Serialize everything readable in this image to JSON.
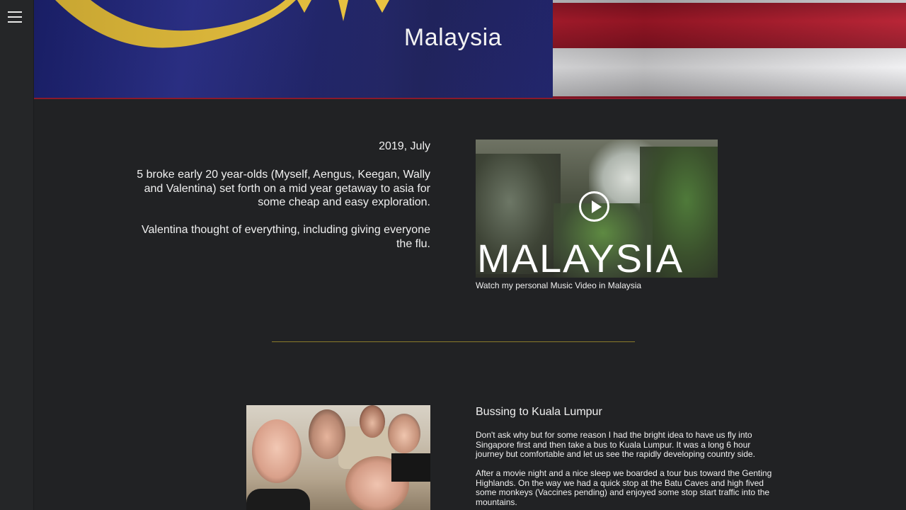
{
  "nav": {
    "menu_icon": "hamburger-menu-icon"
  },
  "banner": {
    "title": "Malaysia",
    "colors": {
      "blue": "#1d2376",
      "red": "#b51a2c",
      "white": "#f0f0f2",
      "yellow": "#e9c13a"
    }
  },
  "intro": {
    "date": "2019, July",
    "paragraphs": [
      "5 broke early 20 year-olds (Myself, Aengus, Keegan, Wally and Valentina) set forth on a mid year getaway to asia for some cheap and easy exploration.",
      "Valentina thought of everything, including giving everyone the flu."
    ]
  },
  "video": {
    "overlay_text": "MALAYSIA",
    "play_icon": "play-circle-icon",
    "caption": "Watch my personal Music Video in Malaysia"
  },
  "divider_color": "#8a7a2a",
  "story": {
    "title": "Bussing to Kuala Lumpur",
    "paragraphs": [
      "Don't ask why but for some reason I had the bright idea to have us fly into Singapore first and then take a bus to Kuala Lumpur. It was a long 6 hour journey but comfortable and let us see the rapidly developing country side.",
      "After a movie night and a nice sleep we boarded a tour bus toward the Genting Highlands. On the way we had a quick stop at the Batu Caves and high fived some monkeys (Vaccines pending) and enjoyed some stop start traffic into the mountains."
    ]
  }
}
